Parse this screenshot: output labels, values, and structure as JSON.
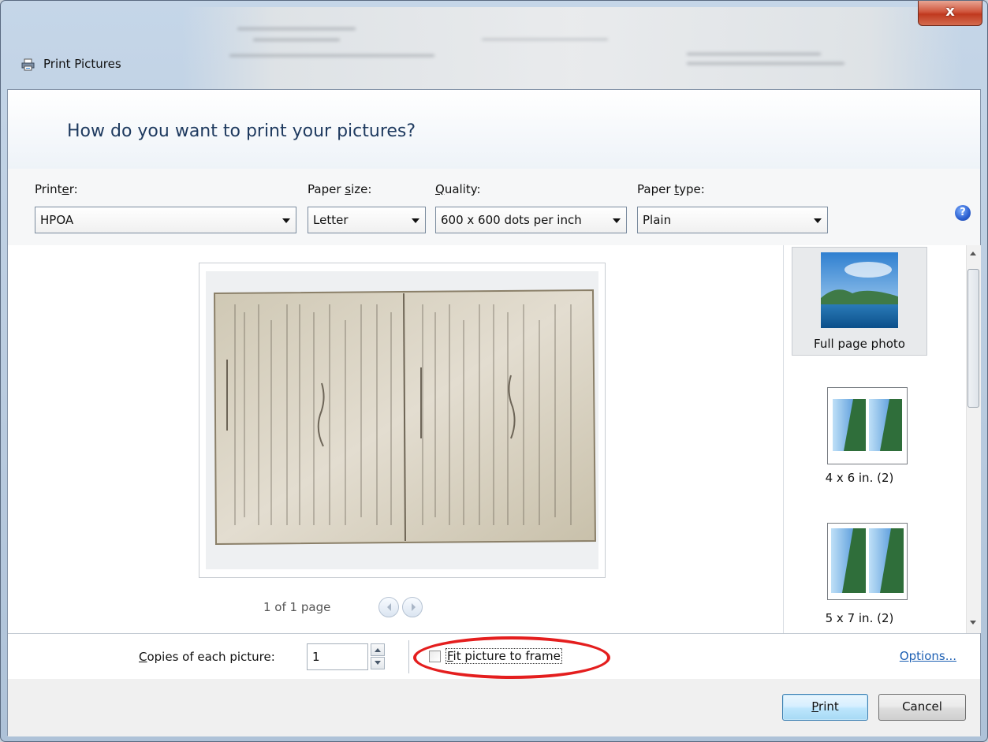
{
  "window": {
    "title": "Print Pictures",
    "close_glyph": "x"
  },
  "header": {
    "question": "How do you want to print your pictures?"
  },
  "toolbar": {
    "printer": {
      "label_pre": "Print",
      "label_key": "e",
      "label_post": "r:",
      "value": "HPOA"
    },
    "paper_size": {
      "label_pre": "Paper ",
      "label_key": "s",
      "label_post": "ize:",
      "value": "Letter"
    },
    "quality": {
      "label_pre": "",
      "label_key": "Q",
      "label_post": "uality:",
      "value": "600 x 600 dots per inch"
    },
    "paper_type": {
      "label_pre": "Paper ",
      "label_key": "t",
      "label_post": "ype:",
      "value": "Plain"
    },
    "help_glyph": "?"
  },
  "preview": {
    "page_indicator": "1 of 1 page"
  },
  "layouts": {
    "items": [
      {
        "label": "Full page photo",
        "selected": true
      },
      {
        "label": "4 x 6 in. (2)",
        "selected": false
      },
      {
        "label": "5 x 7 in. (2)",
        "selected": false
      }
    ]
  },
  "bottom": {
    "copies_label_key": "C",
    "copies_label_rest": "opies of each picture:",
    "copies_value": "1",
    "fit_label_key": "F",
    "fit_label_rest": "it picture to frame",
    "fit_checked": false,
    "options_link": "Options..."
  },
  "footer": {
    "print_key": "P",
    "print_rest": "rint",
    "cancel_label": "Cancel"
  },
  "colors": {
    "accent_blue": "#1e3a5f",
    "link_blue": "#1c5fb3",
    "highlight_red": "#e41e1e"
  }
}
